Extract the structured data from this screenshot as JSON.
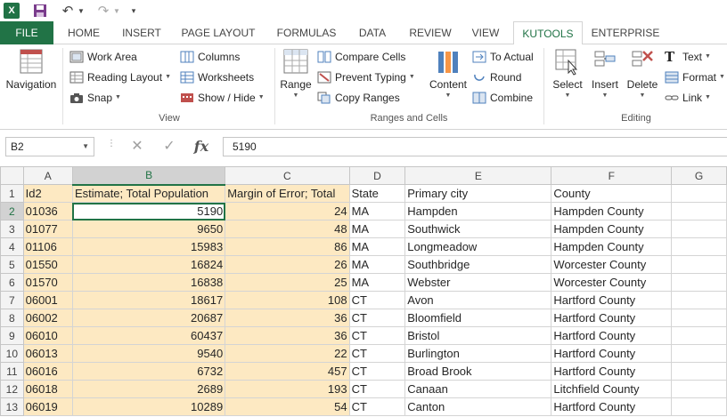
{
  "quick_access": {
    "app_icon": "excel-icon",
    "logo_text": "X",
    "save": "save-icon",
    "undo": "undo-icon",
    "redo": "redo-icon"
  },
  "tabs": [
    {
      "label": "FILE"
    },
    {
      "label": "HOME"
    },
    {
      "label": "INSERT"
    },
    {
      "label": "PAGE LAYOUT"
    },
    {
      "label": "FORMULAS"
    },
    {
      "label": "DATA"
    },
    {
      "label": "REVIEW"
    },
    {
      "label": "VIEW"
    },
    {
      "label": "KUTOOLS"
    },
    {
      "label": "ENTERPRISE"
    }
  ],
  "active_tab": "KUTOOLS",
  "ribbon": {
    "navigation": "Navigation",
    "work_area": "Work Area",
    "reading_layout": "Reading Layout",
    "snap": "Snap",
    "columns": "Columns",
    "worksheets": "Worksheets",
    "show_hide": "Show / Hide",
    "view_group": "View",
    "range": "Range",
    "compare_cells": "Compare Cells",
    "prevent_typing": "Prevent Typing",
    "copy_ranges": "Copy Ranges",
    "content": "Content",
    "to_actual": "To Actual",
    "round": "Round",
    "combine": "Combine",
    "ranges_group": "Ranges and Cells",
    "select": "Select",
    "insert": "Insert",
    "delete": "Delete",
    "text": "Text",
    "format": "Format",
    "link": "Link",
    "editing_group": "Editing"
  },
  "formula_bar": {
    "name_box": "B2",
    "fx": "fx",
    "value": "5190"
  },
  "sheet": {
    "columns": [
      "A",
      "B",
      "C",
      "D",
      "E",
      "F",
      "G"
    ],
    "rows": [
      [
        "Id2",
        "Estimate; Total Population",
        "Margin of Error; Total",
        "State",
        "Primary city",
        "County",
        ""
      ],
      [
        "01036",
        "5190",
        "24",
        "MA",
        "Hampden",
        "Hampden County",
        ""
      ],
      [
        "01077",
        "9650",
        "48",
        "MA",
        "Southwick",
        "Hampden County",
        ""
      ],
      [
        "01106",
        "15983",
        "86",
        "MA",
        "Longmeadow",
        "Hampden County",
        ""
      ],
      [
        "01550",
        "16824",
        "26",
        "MA",
        "Southbridge",
        "Worcester County",
        ""
      ],
      [
        "01570",
        "16838",
        "25",
        "MA",
        "Webster",
        "Worcester County",
        ""
      ],
      [
        "06001",
        "18617",
        "108",
        "CT",
        "Avon",
        "Hartford County",
        ""
      ],
      [
        "06002",
        "20687",
        "36",
        "CT",
        "Bloomfield",
        "Hartford County",
        ""
      ],
      [
        "06010",
        "60437",
        "36",
        "CT",
        "Bristol",
        "Hartford County",
        ""
      ],
      [
        "06013",
        "9540",
        "22",
        "CT",
        "Burlington",
        "Hartford County",
        ""
      ],
      [
        "06016",
        "6732",
        "457",
        "CT",
        "Broad Brook",
        "Hartford County",
        ""
      ],
      [
        "06018",
        "2689",
        "193",
        "CT",
        "Canaan",
        "Litchfield County",
        ""
      ],
      [
        "06019",
        "10289",
        "54",
        "CT",
        "Canton",
        "Hartford County",
        ""
      ]
    ],
    "active_cell": "B2",
    "highlight_color": "#fde9c2",
    "accent_color": "#217346"
  }
}
